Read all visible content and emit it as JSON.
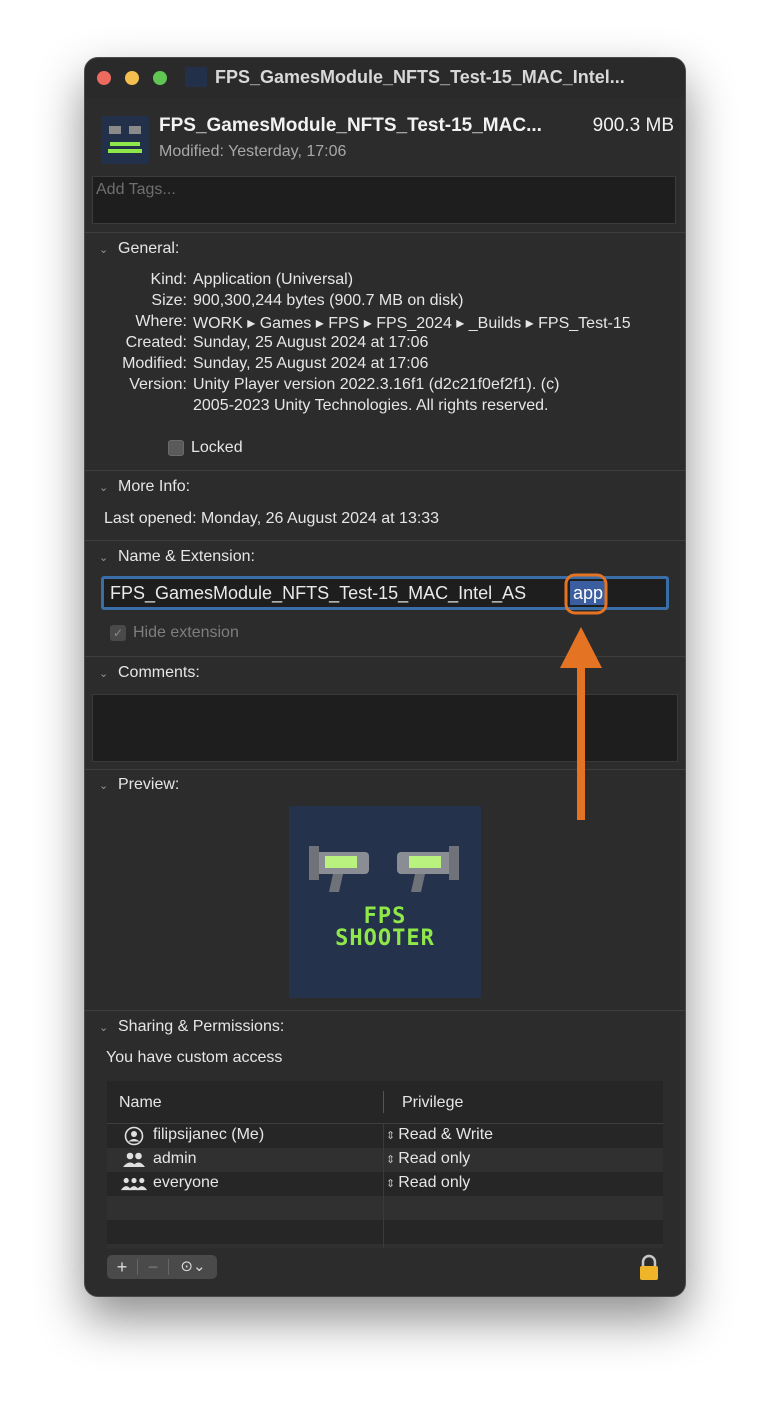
{
  "window": {
    "title": "FPS_GamesModule_NFTS_Test-15_MAC_Intel...",
    "file_name": "FPS_GamesModule_NFTS_Test-15_MAC...",
    "file_size": "900.3 MB",
    "modified": "Modified: Yesterday, 17:06",
    "tags_placeholder": "Add Tags..."
  },
  "general": {
    "title": "General:",
    "rows": [
      {
        "label": "Kind:",
        "value": "Application (Universal)"
      },
      {
        "label": "Size:",
        "value": "900,300,244 bytes (900.7 MB on disk)"
      },
      {
        "label": "Where:",
        "value": "WORK ▸ Games ▸ FPS ▸ FPS_2024 ▸ _Builds ▸ FPS_Test-15"
      },
      {
        "label": "Created:",
        "value": "Sunday, 25 August 2024 at 17:06"
      },
      {
        "label": "Modified:",
        "value": "Sunday, 25 August 2024 at 17:06"
      },
      {
        "label": "Version:",
        "value": "Unity Player version 2022.3.16f1 (d2c21f0ef2f1). (c)"
      },
      {
        "label": "",
        "value": "2005-2023 Unity Technologies. All rights reserved."
      }
    ],
    "locked_label": "Locked"
  },
  "more_info": {
    "title": "More Info:",
    "last_opened": "Last opened: Monday, 26 August 2024 at 13:33"
  },
  "name_ext": {
    "title": "Name & Extension:",
    "name_value": "FPS_GamesModule_NFTS_Test-15_MAC_Intel_AS",
    "ext_selected": "app",
    "hide_extension_label": "Hide extension"
  },
  "comments": {
    "title": "Comments:"
  },
  "preview": {
    "title": "Preview:",
    "line1": "FPS",
    "line2": "SHOOTER"
  },
  "sharing": {
    "title": "Sharing & Permissions:",
    "access_note": "You have custom access",
    "col_name": "Name",
    "col_privilege": "Privilege",
    "rows": [
      {
        "user": "filipsijanec (Me)",
        "icon": "user-circle-icon",
        "privilege": "Read & Write"
      },
      {
        "user": "admin",
        "icon": "group-icon",
        "privilege": "Read only"
      },
      {
        "user": "everyone",
        "icon": "everyone-icon",
        "privilege": "Read only"
      }
    ],
    "add_symbol": "+",
    "remove_symbol": "−",
    "action_symbol": "⊙⌄"
  },
  "colors": {
    "window_bg": "#2c2c2c",
    "selection": "#3a5ea0",
    "focus_ring": "#3a6ea8",
    "annotation_orange": "#e57324",
    "preview_green": "#8fe84a"
  }
}
